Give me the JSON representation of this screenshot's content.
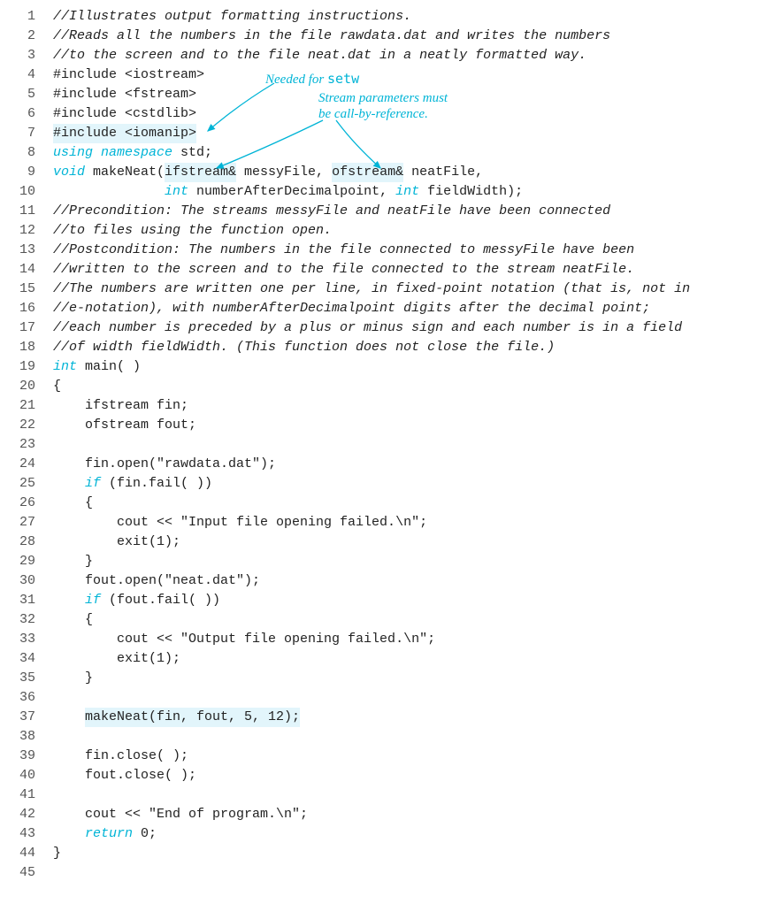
{
  "annotations": {
    "a1_l1": "Needed for ",
    "a1_setw": "setw",
    "a2_l1": "Stream parameters must",
    "a2_l2": "be call-by-reference."
  },
  "nums": {
    "n1": "1",
    "n2": "2",
    "n3": "3",
    "n4": "4",
    "n5": "5",
    "n6": "6",
    "n7": "7",
    "n8": "8",
    "n9": "9",
    "n10": "10",
    "n11": "11",
    "n12": "12",
    "n13": "13",
    "n14": "14",
    "n15": "15",
    "n16": "16",
    "n17": "17",
    "n18": "18",
    "n19": "19",
    "n20": "20",
    "n21": "21",
    "n22": "22",
    "n23": "23",
    "n24": "24",
    "n25": "25",
    "n26": "26",
    "n27": "27",
    "n28": "28",
    "n29": "29",
    "n30": "30",
    "n31": "31",
    "n32": "32",
    "n33": "33",
    "n34": "34",
    "n35": "35",
    "n36": "36",
    "n37": "37",
    "n38": "38",
    "n39": "39",
    "n40": "40",
    "n41": "41",
    "n42": "42",
    "n43": "43",
    "n44": "44",
    "n45": "45"
  },
  "code": {
    "l1": "//Illustrates output formatting instructions.",
    "l2": "//Reads all the numbers in the file rawdata.dat and writes the numbers",
    "l3": "//to the screen and to the file neat.dat in a neatly formatted way.",
    "l4": "#include <iostream>",
    "l5": "#include <fstream>",
    "l6": "#include <cstdlib>",
    "l7": "#include <iomanip>",
    "l8a": "using namespace",
    "l8b": " std;",
    "l9a": "void",
    "l9b": " makeNeat(",
    "l9c": "ifstream&",
    "l9d": " messyFile, ",
    "l9e": "ofstream&",
    "l9f": " neatFile,",
    "l10a": "              ",
    "l10b": "int",
    "l10c": " numberAfterDecimalpoint, ",
    "l10d": "int",
    "l10e": " fieldWidth);",
    "l11": "//Precondition: The streams messyFile and neatFile have been connected",
    "l12": "//to files using the function open.",
    "l13": "//Postcondition: The numbers in the file connected to messyFile have been",
    "l14": "//written to the screen and to the file connected to the stream neatFile.",
    "l15": "//The numbers are written one per line, in fixed-point notation (that is, not in",
    "l16": "//e-notation), with numberAfterDecimalpoint digits after the decimal point;",
    "l17": "//each number is preceded by a plus or minus sign and each number is in a field",
    "l18": "//of width fieldWidth. (This function does not close the file.)",
    "l19a": "int",
    "l19b": " main( )",
    "l20": "{",
    "l21": "    ifstream fin;",
    "l22": "    ofstream fout;",
    "l23": "",
    "l24": "    fin.open(\"rawdata.dat\");",
    "l25a": "    ",
    "l25b": "if",
    "l25c": " (fin.fail( ))",
    "l26": "    {",
    "l27": "        cout << \"Input file opening failed.\\n\";",
    "l28": "        exit(1);",
    "l29": "    }",
    "l30": "    fout.open(\"neat.dat\");",
    "l31a": "    ",
    "l31b": "if",
    "l31c": " (fout.fail( ))",
    "l32": "    {",
    "l33": "        cout << \"Output file opening failed.\\n\";",
    "l34": "        exit(1);",
    "l35": "    }",
    "l36": "",
    "l37a": "    ",
    "l37b": "makeNeat(fin, fout, 5, 12);",
    "l38": "",
    "l39": "    fin.close( );",
    "l40": "    fout.close( );",
    "l41": "",
    "l42": "    cout << \"End of program.\\n\";",
    "l43a": "    ",
    "l43b": "return",
    "l43c": " 0;",
    "l44": "}",
    "l45": ""
  }
}
